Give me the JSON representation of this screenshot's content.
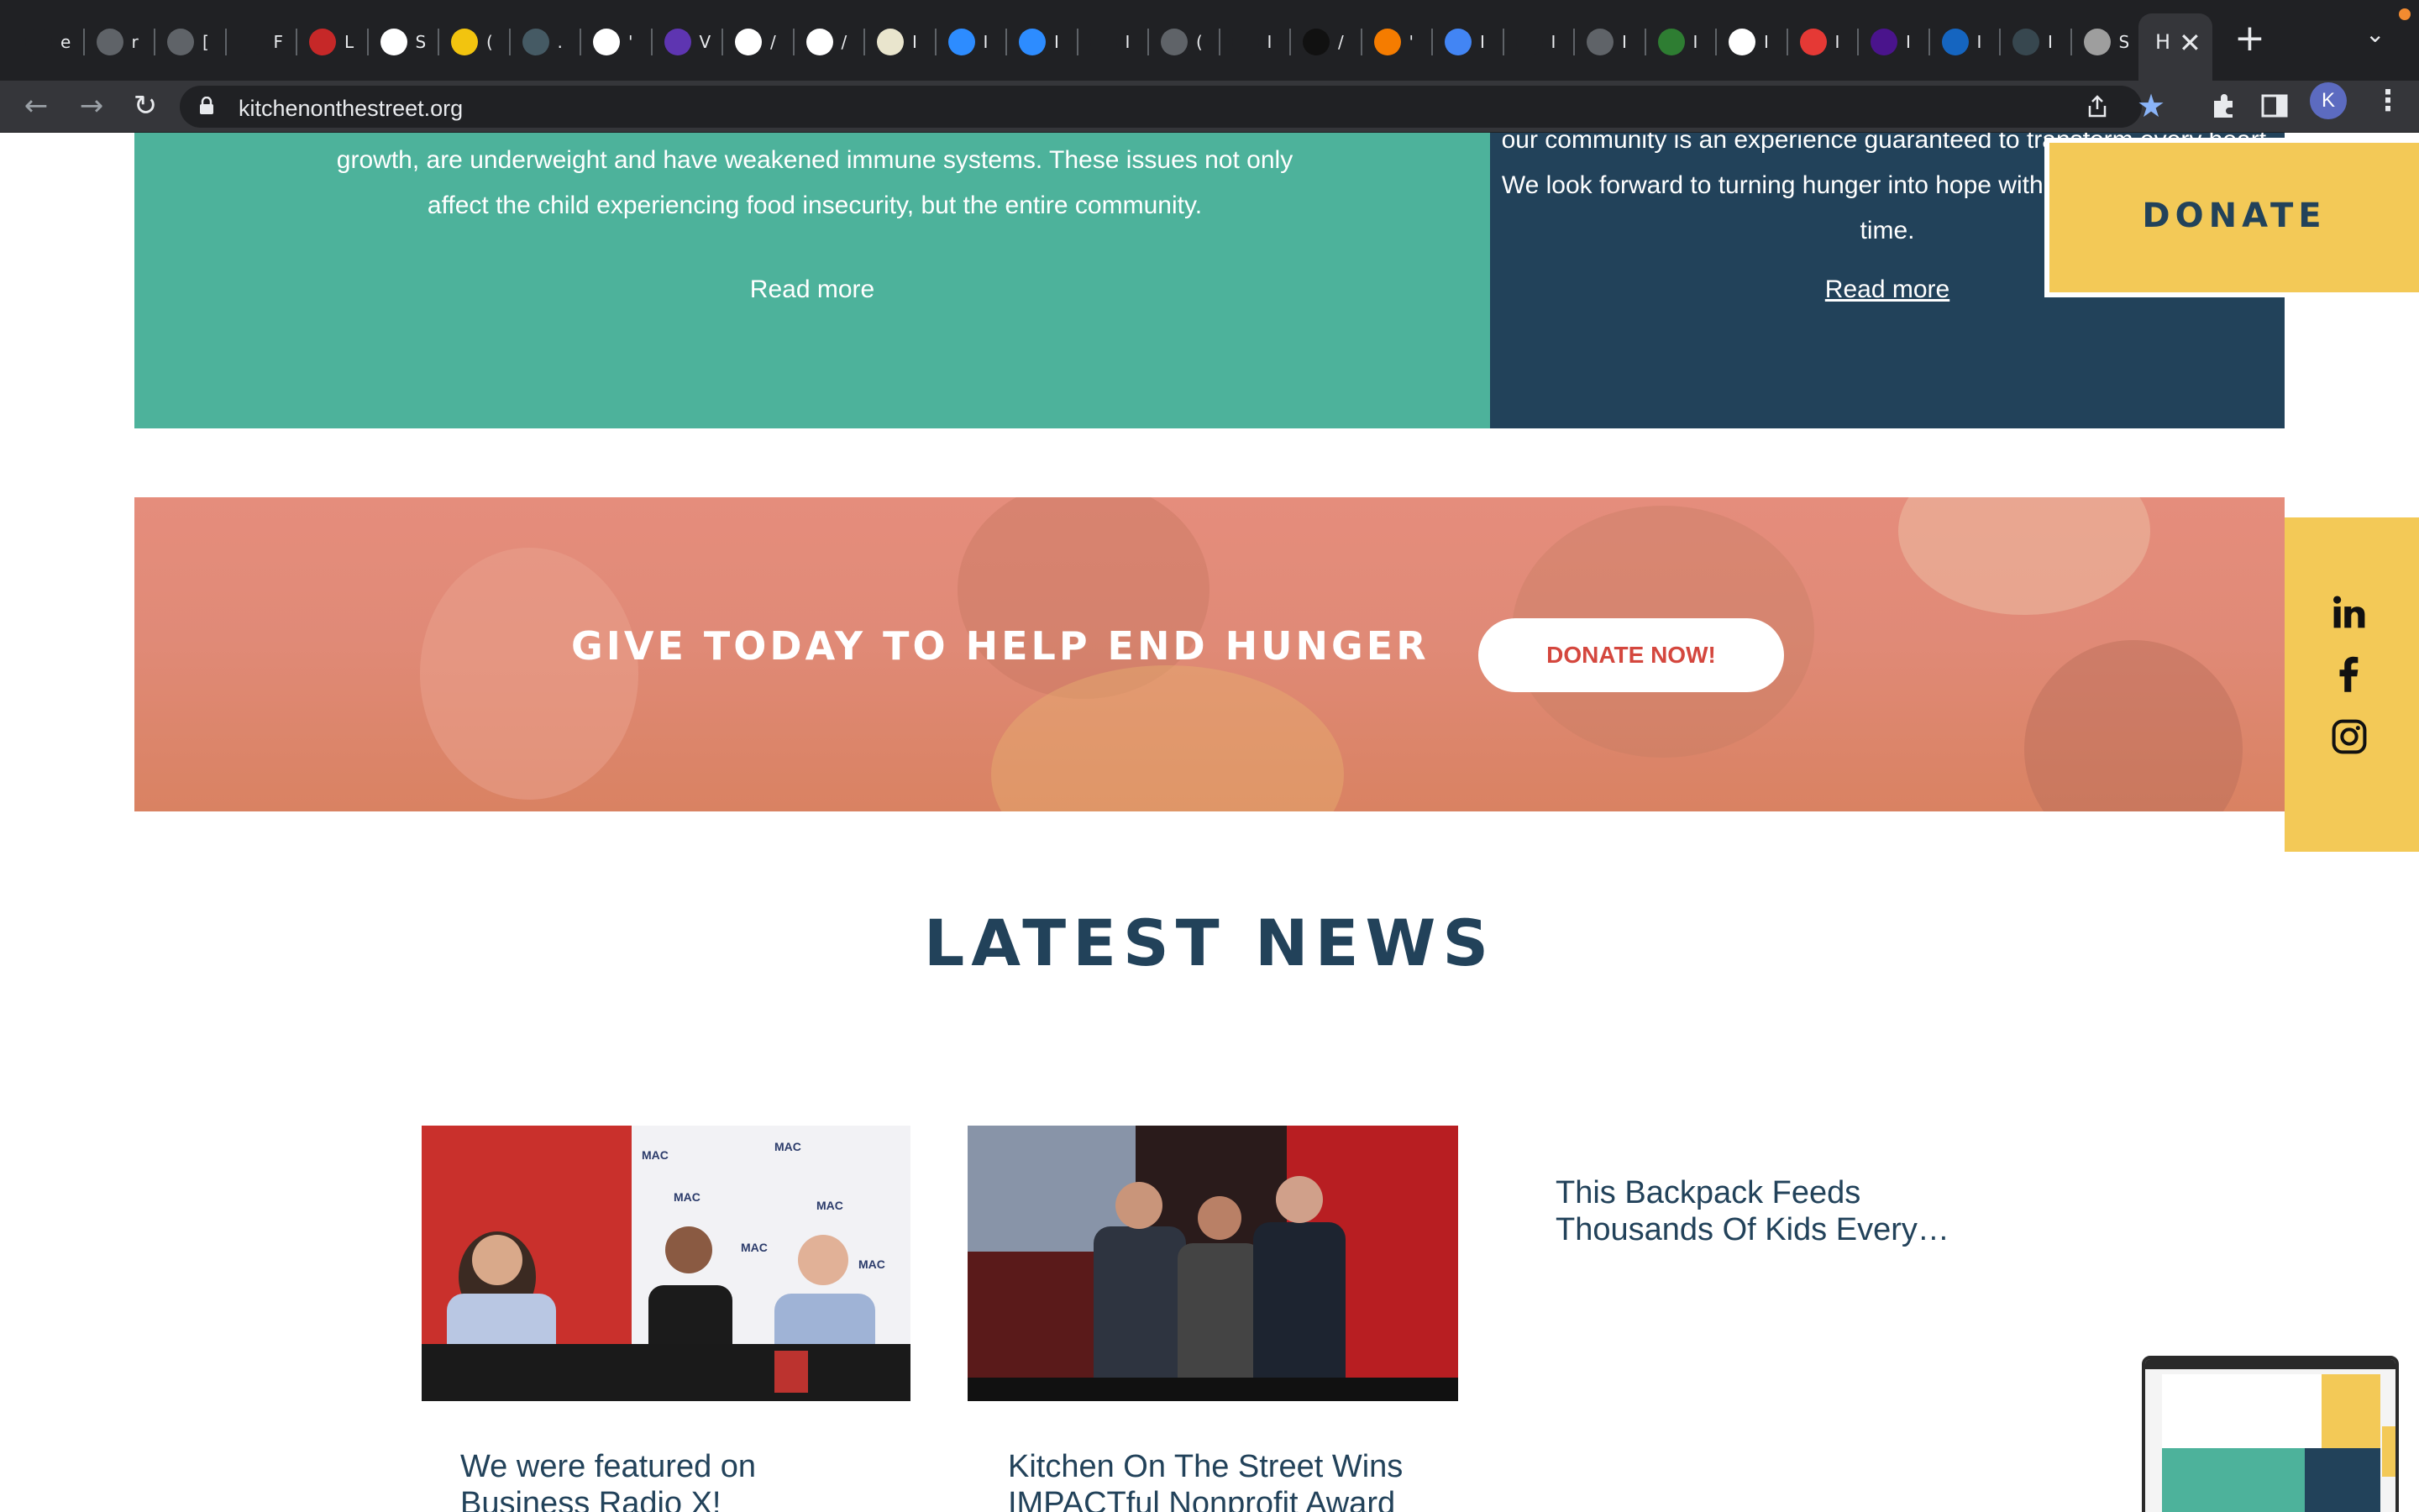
{
  "browser": {
    "tabs": [
      {
        "title": "e",
        "icon": "spiral-icon",
        "color": "#202124"
      },
      {
        "title": "r",
        "icon": "globe-icon",
        "color": "#5f6368"
      },
      {
        "title": "[",
        "icon": "globe-icon",
        "color": "#5f6368"
      },
      {
        "title": "F",
        "icon": "github-icon",
        "color": "#202124"
      },
      {
        "title": "L",
        "icon": "gear-red-icon",
        "color": "#c62828"
      },
      {
        "title": "S",
        "icon": "gmail-icon",
        "color": "#ffffff"
      },
      {
        "title": "(",
        "icon": "m-yellow-icon",
        "color": "#f2c40f"
      },
      {
        "title": ".",
        "icon": "vehicle-icon",
        "color": "#455a64"
      },
      {
        "title": "'",
        "icon": "google-icon",
        "color": "#ffffff"
      },
      {
        "title": "V",
        "icon": "purple-list-icon",
        "color": "#5e35b1"
      },
      {
        "title": "/",
        "icon": "amazon-icon",
        "color": "#ffffff"
      },
      {
        "title": "/",
        "icon": "amazon-icon",
        "color": "#ffffff"
      },
      {
        "title": "I",
        "icon": "goodreads-icon",
        "color": "#e9e5cd"
      },
      {
        "title": "I",
        "icon": "zoom-icon",
        "color": "#2d8cff"
      },
      {
        "title": "I",
        "icon": "zoom-icon",
        "color": "#2d8cff"
      },
      {
        "title": "I",
        "icon": "github-icon",
        "color": "#202124"
      },
      {
        "title": "(",
        "icon": "globe-icon",
        "color": "#5f6368"
      },
      {
        "title": "I",
        "icon": "chrome-icon",
        "color": "#202124"
      },
      {
        "title": "/",
        "icon": "amazon-dark-icon",
        "color": "#111111"
      },
      {
        "title": "'",
        "icon": "orange-flower-icon",
        "color": "#f57c00"
      },
      {
        "title": "I",
        "icon": "docs-icon",
        "color": "#4285f4"
      },
      {
        "title": "I",
        "icon": "chrome-icon",
        "color": "#202124"
      },
      {
        "title": "I",
        "icon": "globe-icon",
        "color": "#5f6368"
      },
      {
        "title": "I",
        "icon": "green-heart-icon",
        "color": "#2e7d32"
      },
      {
        "title": "I",
        "icon": "frac-icon",
        "color": "#ffffff"
      },
      {
        "title": "I",
        "icon": "colorwheel-icon",
        "color": "#e53935"
      },
      {
        "title": "I",
        "icon": "purple-figure-icon",
        "color": "#4a148c"
      },
      {
        "title": "I",
        "icon": "cdc-icon",
        "color": "#1565c0"
      },
      {
        "title": "I",
        "icon": "news-icon",
        "color": "#37474f"
      },
      {
        "title": "S",
        "icon": "smile-icon",
        "color": "#9e9e9e"
      }
    ],
    "active_tab": {
      "title": "H"
    },
    "url": "kitchenonthestreet.org",
    "profile_initial": "K"
  },
  "hunger_card": {
    "body": "growth, are underweight and have weakened immune systems. These issues not only affect the child experiencing food insecurity, but the entire community.",
    "read_more": "Read more"
  },
  "involved_card": {
    "body": "our community is an experience guaranteed to transform every heart.  We look forward to turning hunger into hope with you… one child at a time.",
    "read_more": "Read more"
  },
  "donate_float": {
    "label": "DONATE"
  },
  "banner": {
    "headline": "GIVE TODAY TO HELP END HUNGER",
    "button": "DONATE NOW!"
  },
  "social": [
    {
      "name": "linkedin-icon"
    },
    {
      "name": "facebook-icon"
    },
    {
      "name": "instagram-icon"
    }
  ],
  "news": {
    "title": "LATEST NEWS",
    "items": [
      {
        "headline": "We were featured on Business Radio X!"
      },
      {
        "headline": "Kitchen On The Street Wins IMPACTful Nonprofit Award"
      },
      {
        "headline": "This Backpack Feeds Thousands Of Kids Every…"
      }
    ]
  },
  "colors": {
    "teal": "#4db29b",
    "navy": "#22425a",
    "yellow": "#f3c957",
    "coral": "#e08a77",
    "donate_red": "#d4473e"
  }
}
